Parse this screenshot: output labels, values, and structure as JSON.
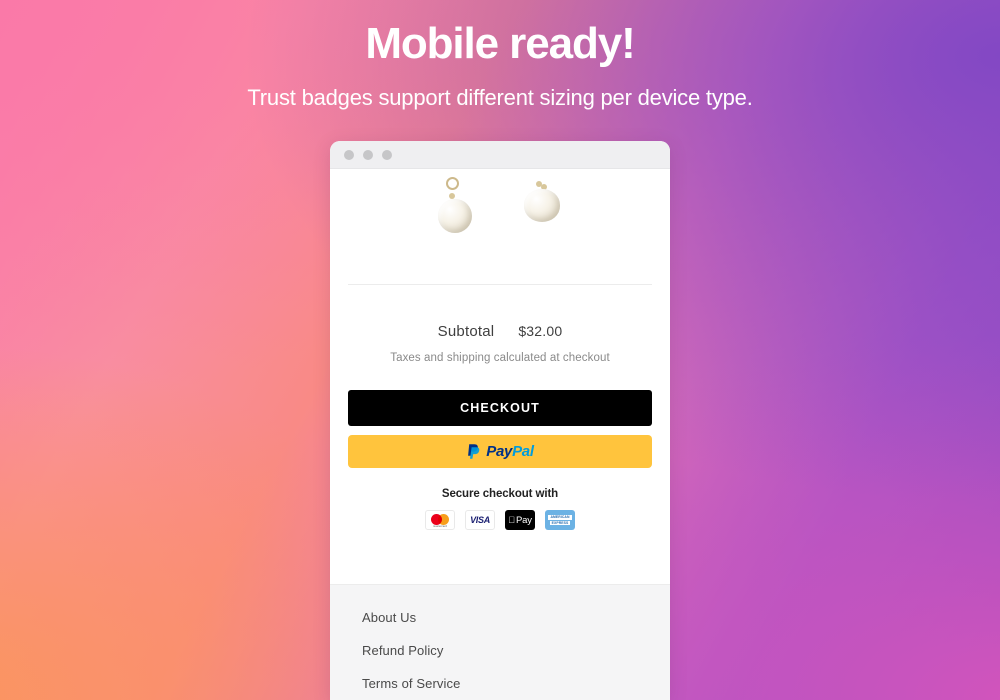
{
  "hero": {
    "title": "Mobile ready!",
    "subtitle": "Trust badges support different sizing per device type."
  },
  "browser": {
    "traffic_lights": [
      "close-dot",
      "minimize-dot",
      "maximize-dot"
    ]
  },
  "product": {
    "image_alt": "pearl-drop-earrings"
  },
  "cart": {
    "subtotal_label": "Subtotal",
    "subtotal_value": "$32.00",
    "tax_note": "Taxes and shipping calculated at checkout"
  },
  "actions": {
    "checkout_label": "CHECKOUT",
    "paypal_pay": "Pay",
    "paypal_pal": "Pal"
  },
  "secure": {
    "label": "Secure checkout with",
    "badges": [
      {
        "name": "mastercard",
        "text": "mastercard"
      },
      {
        "name": "visa",
        "text": "VISA"
      },
      {
        "name": "apple-pay",
        "text": "Pay"
      },
      {
        "name": "american-express",
        "line1": "AMERICAN",
        "line2": "EXPRESS"
      }
    ]
  },
  "footer": {
    "links": [
      {
        "label": "About Us"
      },
      {
        "label": "Refund Policy"
      },
      {
        "label": "Terms of Service"
      }
    ]
  },
  "colors": {
    "gradient_top_left": "#fa79a8",
    "gradient_top_right": "#8348c4",
    "gradient_bottom_left": "#fb955a",
    "gradient_bottom_right": "#d355bc",
    "checkout_bg": "#000000",
    "paypal_bg": "#ffc43d",
    "paypal_navy": "#003087",
    "paypal_blue": "#009cde",
    "footer_bg": "#f5f5f6"
  }
}
